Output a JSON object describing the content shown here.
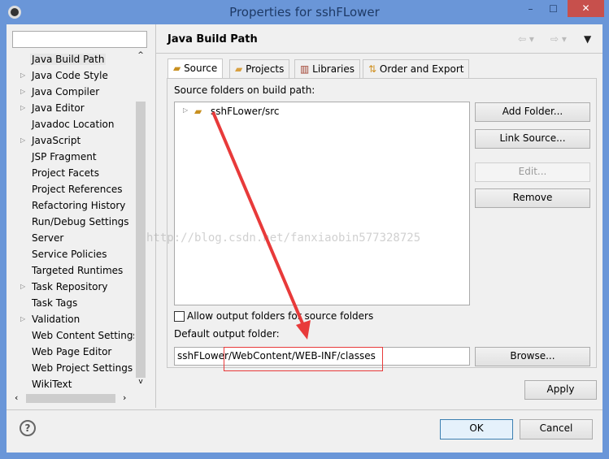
{
  "window": {
    "title": "Properties for sshFLower",
    "minimize": "–",
    "maximize": "☐",
    "close": "✕"
  },
  "sidebar": {
    "filter_value": "",
    "items": [
      {
        "label": "Java Build Path",
        "expandable": false,
        "selected": true
      },
      {
        "label": "Java Code Style",
        "expandable": true
      },
      {
        "label": "Java Compiler",
        "expandable": true
      },
      {
        "label": "Java Editor",
        "expandable": true
      },
      {
        "label": "Javadoc Location",
        "expandable": false
      },
      {
        "label": "JavaScript",
        "expandable": true
      },
      {
        "label": "JSP Fragment",
        "expandable": false
      },
      {
        "label": "Project Facets",
        "expandable": false
      },
      {
        "label": "Project References",
        "expandable": false
      },
      {
        "label": "Refactoring History",
        "expandable": false
      },
      {
        "label": "Run/Debug Settings",
        "expandable": false
      },
      {
        "label": "Server",
        "expandable": false
      },
      {
        "label": "Service Policies",
        "expandable": false
      },
      {
        "label": "Targeted Runtimes",
        "expandable": false
      },
      {
        "label": "Task Repository",
        "expandable": true
      },
      {
        "label": "Task Tags",
        "expandable": false
      },
      {
        "label": "Validation",
        "expandable": true
      },
      {
        "label": "Web Content Settings",
        "expandable": false
      },
      {
        "label": "Web Page Editor",
        "expandable": false
      },
      {
        "label": "Web Project Settings",
        "expandable": false
      },
      {
        "label": "WikiText",
        "expandable": false
      }
    ]
  },
  "header": {
    "title": "Java Build Path"
  },
  "tabs": [
    {
      "label": "Source",
      "active": true
    },
    {
      "label": "Projects"
    },
    {
      "label": "Libraries"
    },
    {
      "label": "Order and Export"
    }
  ],
  "source": {
    "label": "Source folders on build path:",
    "tree": [
      {
        "label": "sshFLower/src"
      }
    ],
    "buttons": {
      "add_folder": "Add Folder...",
      "link_source": "Link Source...",
      "edit": "Edit...",
      "remove": "Remove"
    },
    "allow_output_label": "Allow output folders for source folders",
    "allow_output_checked": false,
    "default_output_label": "Default output folder:",
    "default_output_value": "sshFLower/WebContent/WEB-INF/classes",
    "browse": "Browse..."
  },
  "apply": "Apply",
  "ok": "OK",
  "cancel": "Cancel",
  "watermark": "http://blog.csdn.net/fanxiaobin577328725",
  "colors": {
    "window_border": "#6a96d8",
    "close_button": "#c7504c",
    "annotation": "#e83a3a"
  }
}
